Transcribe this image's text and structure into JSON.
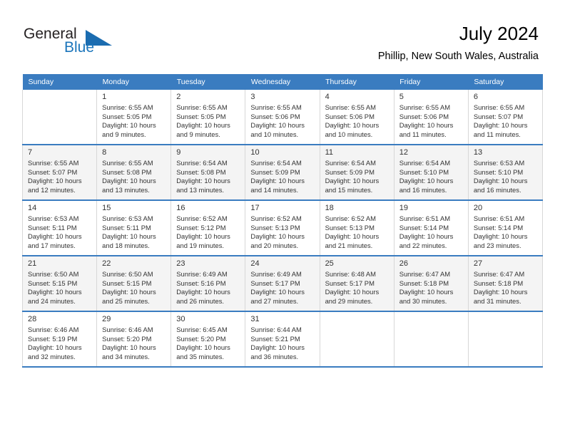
{
  "brand": {
    "name_part1": "General",
    "name_part2": "Blue",
    "accent_color": "#1b75bb"
  },
  "header": {
    "month_title": "July 2024",
    "location": "Phillip, New South Wales, Australia"
  },
  "calendar": {
    "header_bg": "#3a7cc0",
    "weekday_headers": [
      "Sunday",
      "Monday",
      "Tuesday",
      "Wednesday",
      "Thursday",
      "Friday",
      "Saturday"
    ],
    "weeks": [
      {
        "shaded": false,
        "days": [
          {
            "num": "",
            "detail": ""
          },
          {
            "num": "1",
            "detail": "Sunrise: 6:55 AM\nSunset: 5:05 PM\nDaylight: 10 hours\nand 9 minutes."
          },
          {
            "num": "2",
            "detail": "Sunrise: 6:55 AM\nSunset: 5:05 PM\nDaylight: 10 hours\nand 9 minutes."
          },
          {
            "num": "3",
            "detail": "Sunrise: 6:55 AM\nSunset: 5:06 PM\nDaylight: 10 hours\nand 10 minutes."
          },
          {
            "num": "4",
            "detail": "Sunrise: 6:55 AM\nSunset: 5:06 PM\nDaylight: 10 hours\nand 10 minutes."
          },
          {
            "num": "5",
            "detail": "Sunrise: 6:55 AM\nSunset: 5:06 PM\nDaylight: 10 hours\nand 11 minutes."
          },
          {
            "num": "6",
            "detail": "Sunrise: 6:55 AM\nSunset: 5:07 PM\nDaylight: 10 hours\nand 11 minutes."
          }
        ]
      },
      {
        "shaded": true,
        "days": [
          {
            "num": "7",
            "detail": "Sunrise: 6:55 AM\nSunset: 5:07 PM\nDaylight: 10 hours\nand 12 minutes."
          },
          {
            "num": "8",
            "detail": "Sunrise: 6:55 AM\nSunset: 5:08 PM\nDaylight: 10 hours\nand 13 minutes."
          },
          {
            "num": "9",
            "detail": "Sunrise: 6:54 AM\nSunset: 5:08 PM\nDaylight: 10 hours\nand 13 minutes."
          },
          {
            "num": "10",
            "detail": "Sunrise: 6:54 AM\nSunset: 5:09 PM\nDaylight: 10 hours\nand 14 minutes."
          },
          {
            "num": "11",
            "detail": "Sunrise: 6:54 AM\nSunset: 5:09 PM\nDaylight: 10 hours\nand 15 minutes."
          },
          {
            "num": "12",
            "detail": "Sunrise: 6:54 AM\nSunset: 5:10 PM\nDaylight: 10 hours\nand 16 minutes."
          },
          {
            "num": "13",
            "detail": "Sunrise: 6:53 AM\nSunset: 5:10 PM\nDaylight: 10 hours\nand 16 minutes."
          }
        ]
      },
      {
        "shaded": false,
        "days": [
          {
            "num": "14",
            "detail": "Sunrise: 6:53 AM\nSunset: 5:11 PM\nDaylight: 10 hours\nand 17 minutes."
          },
          {
            "num": "15",
            "detail": "Sunrise: 6:53 AM\nSunset: 5:11 PM\nDaylight: 10 hours\nand 18 minutes."
          },
          {
            "num": "16",
            "detail": "Sunrise: 6:52 AM\nSunset: 5:12 PM\nDaylight: 10 hours\nand 19 minutes."
          },
          {
            "num": "17",
            "detail": "Sunrise: 6:52 AM\nSunset: 5:13 PM\nDaylight: 10 hours\nand 20 minutes."
          },
          {
            "num": "18",
            "detail": "Sunrise: 6:52 AM\nSunset: 5:13 PM\nDaylight: 10 hours\nand 21 minutes."
          },
          {
            "num": "19",
            "detail": "Sunrise: 6:51 AM\nSunset: 5:14 PM\nDaylight: 10 hours\nand 22 minutes."
          },
          {
            "num": "20",
            "detail": "Sunrise: 6:51 AM\nSunset: 5:14 PM\nDaylight: 10 hours\nand 23 minutes."
          }
        ]
      },
      {
        "shaded": true,
        "days": [
          {
            "num": "21",
            "detail": "Sunrise: 6:50 AM\nSunset: 5:15 PM\nDaylight: 10 hours\nand 24 minutes."
          },
          {
            "num": "22",
            "detail": "Sunrise: 6:50 AM\nSunset: 5:15 PM\nDaylight: 10 hours\nand 25 minutes."
          },
          {
            "num": "23",
            "detail": "Sunrise: 6:49 AM\nSunset: 5:16 PM\nDaylight: 10 hours\nand 26 minutes."
          },
          {
            "num": "24",
            "detail": "Sunrise: 6:49 AM\nSunset: 5:17 PM\nDaylight: 10 hours\nand 27 minutes."
          },
          {
            "num": "25",
            "detail": "Sunrise: 6:48 AM\nSunset: 5:17 PM\nDaylight: 10 hours\nand 29 minutes."
          },
          {
            "num": "26",
            "detail": "Sunrise: 6:47 AM\nSunset: 5:18 PM\nDaylight: 10 hours\nand 30 minutes."
          },
          {
            "num": "27",
            "detail": "Sunrise: 6:47 AM\nSunset: 5:18 PM\nDaylight: 10 hours\nand 31 minutes."
          }
        ]
      },
      {
        "shaded": false,
        "days": [
          {
            "num": "28",
            "detail": "Sunrise: 6:46 AM\nSunset: 5:19 PM\nDaylight: 10 hours\nand 32 minutes."
          },
          {
            "num": "29",
            "detail": "Sunrise: 6:46 AM\nSunset: 5:20 PM\nDaylight: 10 hours\nand 34 minutes."
          },
          {
            "num": "30",
            "detail": "Sunrise: 6:45 AM\nSunset: 5:20 PM\nDaylight: 10 hours\nand 35 minutes."
          },
          {
            "num": "31",
            "detail": "Sunrise: 6:44 AM\nSunset: 5:21 PM\nDaylight: 10 hours\nand 36 minutes."
          },
          {
            "num": "",
            "detail": ""
          },
          {
            "num": "",
            "detail": ""
          },
          {
            "num": "",
            "detail": ""
          }
        ]
      }
    ]
  }
}
